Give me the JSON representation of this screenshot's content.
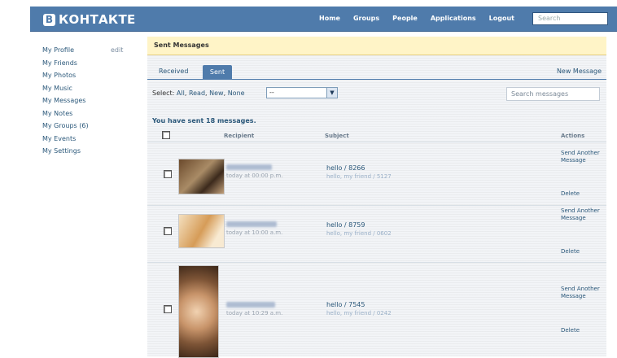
{
  "header": {
    "logo_badge": "B",
    "logo_text": "КОНТАКТЕ",
    "nav": [
      "Home",
      "Groups",
      "People",
      "Applications",
      "Logout"
    ],
    "search_placeholder": "Search"
  },
  "sidebar": {
    "edit_label": "edit",
    "items": [
      "My Profile",
      "My Friends",
      "My Photos",
      "My Music",
      "My Messages",
      "My Notes",
      "My Groups (6)",
      "My Events",
      "My Settings"
    ]
  },
  "page": {
    "title": "Sent Messages",
    "tabs": {
      "received": "Received",
      "sent": "Sent"
    },
    "new_message": "New Message",
    "select_prefix": "Select:",
    "select_options": [
      "All",
      "Read",
      "New",
      "None"
    ],
    "filter_value": "--",
    "search_placeholder": "Search messages",
    "sent_count": "You have sent 18 messages."
  },
  "table": {
    "headers": {
      "recipient": "Recipient",
      "subject": "Subject",
      "actions": "Actions"
    },
    "action_send": "Send Another Message",
    "action_delete": "Delete",
    "rows": [
      {
        "time": "today at 00:00 p.m.",
        "subject": "hello / 8266",
        "preview": "hello, my friend / 5127"
      },
      {
        "time": "today at 10:00 a.m.",
        "subject": "hello / 8759",
        "preview": "hello, my friend / 0602"
      },
      {
        "time": "today at 10:29 a.m.",
        "subject": "hello / 7545",
        "preview": "hello, my friend / 0242"
      }
    ]
  },
  "colors": {
    "brand": "#4f7bab",
    "link": "#2b587a",
    "title_bar": "#fff4c7"
  }
}
